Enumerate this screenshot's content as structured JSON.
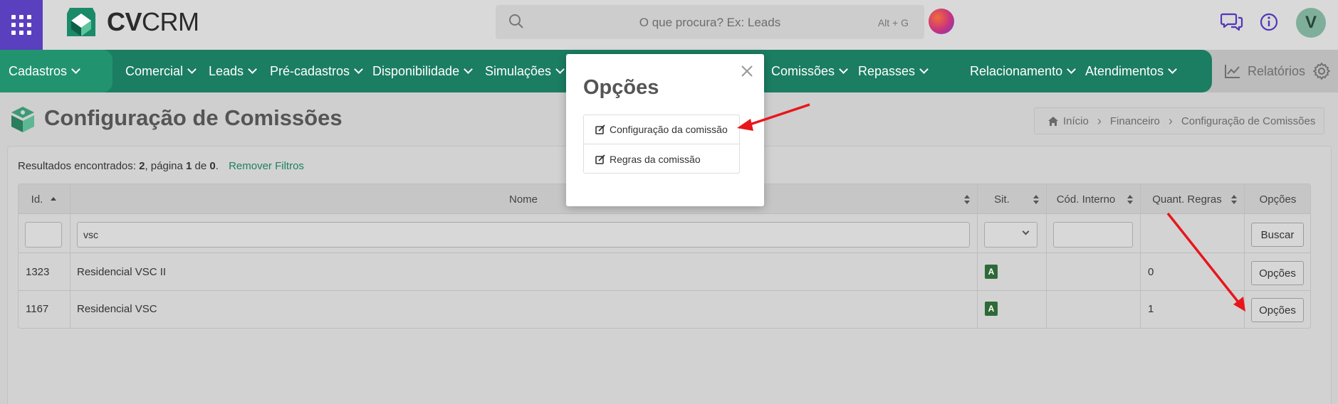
{
  "topbar": {
    "brand_bold": "CV",
    "brand_light": "CRM",
    "search_placeholder": "O que procura? Ex: Leads",
    "search_hotkey": "Alt + G",
    "avatar_initial": "V"
  },
  "nav": {
    "items": [
      {
        "label": "Cadastros"
      },
      {
        "label": "Comercial"
      },
      {
        "label": "Leads"
      },
      {
        "label": "Pré-cadastros"
      },
      {
        "label": "Disponibilidade"
      },
      {
        "label": "Simulações"
      },
      {
        "label": "Comissões"
      },
      {
        "label": "Repasses"
      },
      {
        "label": "Relacionamento"
      },
      {
        "label": "Atendimentos"
      }
    ],
    "reports_label": "Relatórios"
  },
  "page": {
    "title": "Configuração de Comissões",
    "breadcrumb": [
      "Início",
      "Financeiro",
      "Configuração de Comissões"
    ]
  },
  "results": {
    "prefix": "Resultados encontrados: ",
    "count": "2",
    "page_text": ", página ",
    "page": "1",
    "of_text": " de ",
    "total_pages": "0",
    "end": ".",
    "remove_filters": "Remover Filtros"
  },
  "table": {
    "columns": [
      "Id.",
      "Nome",
      "Sit.",
      "Cód. Interno",
      "Quant. Regras",
      "Opções"
    ],
    "filters": {
      "id": "",
      "nome": "vsc",
      "cod": ""
    },
    "search_button": "Buscar",
    "rows": [
      {
        "id": "1323",
        "nome": "Residencial VSC II",
        "sit": "A",
        "cod": "",
        "regras": "0",
        "opcoes": "Opções"
      },
      {
        "id": "1167",
        "nome": "Residencial VSC",
        "sit": "A",
        "cod": "",
        "regras": "1",
        "opcoes": "Opções"
      }
    ]
  },
  "modal": {
    "title": "Opções",
    "items": [
      {
        "label": "Configuração da comissão"
      },
      {
        "label": "Regras da comissão"
      }
    ]
  },
  "colors": {
    "nav_green": "#1b7d62",
    "apps_purple": "#5a3fbf",
    "badge_green": "#2d6a37",
    "arrow_red": "#e8161b"
  }
}
